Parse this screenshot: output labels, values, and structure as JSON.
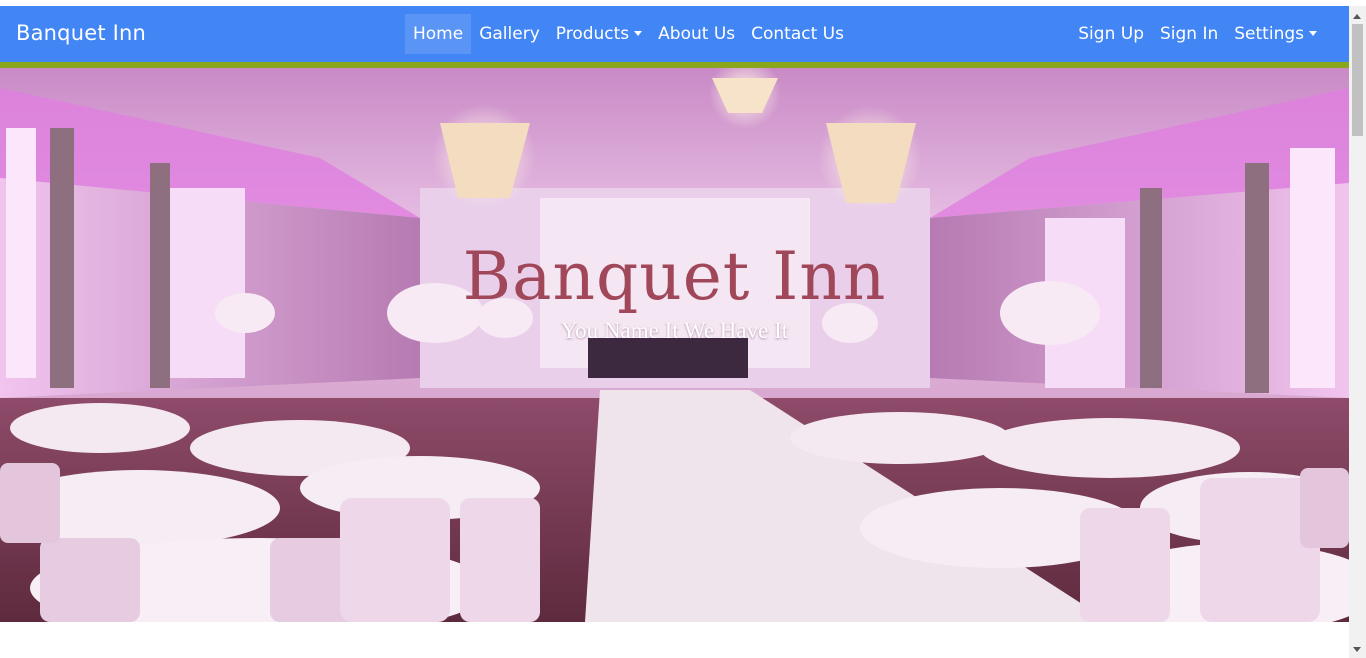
{
  "navbar": {
    "brand": "Banquet Inn",
    "center_items": [
      {
        "label": "Home",
        "active": true
      },
      {
        "label": "Gallery"
      },
      {
        "label": "Products",
        "dropdown": true
      },
      {
        "label": "About Us"
      },
      {
        "label": "Contact Us"
      }
    ],
    "right_items": [
      {
        "label": "Sign Up"
      },
      {
        "label": "Sign In"
      },
      {
        "label": "Settings",
        "dropdown": true
      }
    ],
    "colors": {
      "background": "#4285f4",
      "accent_bar": "#8aa61a"
    }
  },
  "hero": {
    "title": "Banquet Inn",
    "subtitle": "You Name It We Have It",
    "colors": {
      "title": "#a0475a",
      "subtitle": "#ffffff"
    }
  }
}
